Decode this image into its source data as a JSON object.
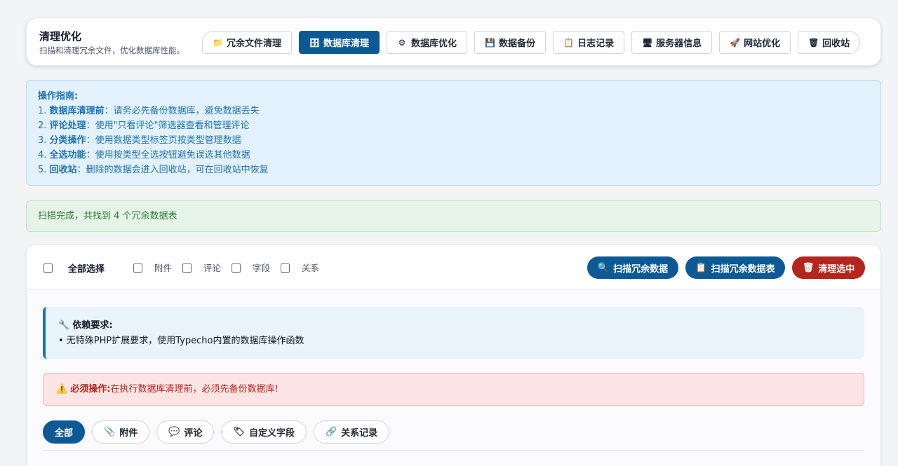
{
  "header": {
    "title": "清理优化",
    "subtitle": "扫描和清理冗余文件，优化数据库性能。",
    "tabs": [
      {
        "icon": "📁",
        "label": "冗余文件清理"
      },
      {
        "icon": "🗄",
        "label": "数据库清理",
        "active": true
      },
      {
        "icon": "⚙",
        "label": "数据库优化"
      },
      {
        "icon": "💾",
        "label": "数据备份"
      },
      {
        "icon": "📋",
        "label": "日志记录"
      },
      {
        "icon": "🖥",
        "label": "服务器信息"
      },
      {
        "icon": "🚀",
        "label": "网站优化"
      },
      {
        "icon": "🗑",
        "label": "回收站"
      }
    ]
  },
  "guide": {
    "title": "操作指南:",
    "items": [
      {
        "num": "1.",
        "key": "数据库清理前",
        "text": "：请务必先备份数据库，避免数据丢失"
      },
      {
        "num": "2.",
        "key": "评论处理",
        "text": "：使用\"只看评论\"筛选器查看和管理评论"
      },
      {
        "num": "3.",
        "key": "分类操作",
        "text": "：使用数据类型标签页按类型管理数据"
      },
      {
        "num": "4.",
        "key": "全选功能",
        "text": "：使用按类型全选按钮避免误选其他数据"
      },
      {
        "num": "5.",
        "key": "回收站",
        "text": "：删除的数据会进入回收站，可在回收站中恢复"
      }
    ]
  },
  "success_message": "扫描完成，共找到 4 个冗余数据表",
  "toolbar": {
    "select_all": "全部选择",
    "types": [
      "附件",
      "评论",
      "字段",
      "关系"
    ],
    "scan_data": "扫描冗余数据",
    "scan_tables": "扫描冗余数据表",
    "clean_selected": "清理选中",
    "scan_data_icon": "🔍",
    "scan_tables_icon": "📋",
    "clean_icon": "🗑"
  },
  "dependency": {
    "icon": "🔧",
    "title": "依赖要求:",
    "line": "• 无特殊PHP扩展要求，使用Typecho内置的数据库操作函数"
  },
  "warning": {
    "icon": "⚠️",
    "label": "必须操作:",
    "text": "在执行数据库清理前，必须先备份数据库!"
  },
  "filters": [
    {
      "icon": "",
      "label": "全部",
      "active": true
    },
    {
      "icon": "📎",
      "label": "附件"
    },
    {
      "icon": "💬",
      "label": "评论"
    },
    {
      "icon": "🏷",
      "label": "自定义字段"
    },
    {
      "icon": "🔗",
      "label": "关系记录"
    }
  ],
  "colors": {
    "primary": "#0b5a96",
    "danger": "#b3261e",
    "success": "#2e7d32",
    "info": "#1e73b3"
  }
}
